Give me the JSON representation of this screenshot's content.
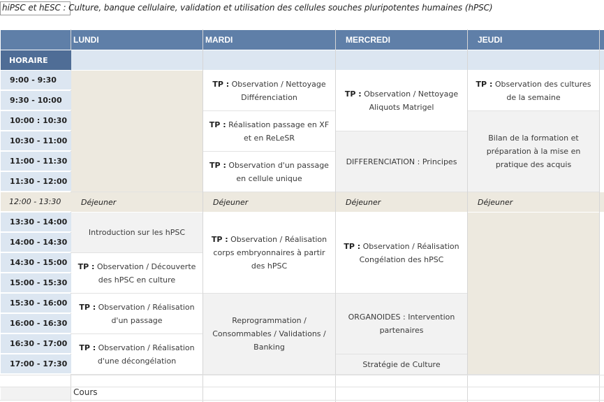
{
  "title": "hiPSC et hESC : Culture, banque cellulaire, validation et utilisation des cellules souches pluripotentes humaines (hPSC)",
  "days": [
    "LUNDI",
    "MARDI",
    "MERCREDI",
    "JEUDI"
  ],
  "horaire_label": "HORAIRE",
  "times": [
    "9:00 - 9:30",
    "9:30 - 10:00",
    "10:00 : 10:30",
    "10:30 - 11:00",
    "11:00 - 11:30",
    "11:30 - 12:00",
    "12:00 - 13:30",
    "13:30 - 14:00",
    "14:00 - 14:30",
    "14:30 - 15:00",
    "15:00 - 15:30",
    "15:30 - 16:00",
    "16:00 - 16:30",
    "16:30 - 17:00",
    "17:00 - 17:30"
  ],
  "lunch_label": "Déjeuner",
  "tp_prefix": "TP :",
  "cells": {
    "mardi_1": "Observation / Nettoyage Différenciation",
    "mardi_2": "Réalisation passage en XF et en ReLeSR",
    "mardi_3": "Observation d'un passage en cellule unique",
    "mercredi_1": "Observation /  Nettoyage Aliquots Matrigel",
    "mercredi_2": "DIFFERENCIATION : Principes",
    "jeudi_1": "Observation des cultures de la semaine",
    "jeudi_2": "Bilan de la formation et préparation à la mise en pratique des acquis",
    "lundi_pm_1": "Introduction sur les hPSC",
    "lundi_pm_2": "Observation / Découverte des hPSC en culture",
    "lundi_pm_3": "Observation / Réalisation d'un passage",
    "lundi_pm_4": "Observation / Réalisation d'une décongélation",
    "mardi_pm_1": "Observation / Réalisation corps embryonnaires à partir des hPSC",
    "mardi_pm_2": "Reprogrammation / Consommables / Validations / Banking",
    "mercredi_pm_1": "Observation / Réalisation Congélation des hPSC",
    "mercredi_pm_2": "ORGANOIDES : Intervention partenaires",
    "mercredi_pm_3": "Stratégie de Culture"
  },
  "legend": "Cours",
  "colors": {
    "header_blue": "#5f7fa8",
    "horaire_blue": "#4f6d96",
    "time_bg": "#dce6f1",
    "lunch_bg": "#ede9df",
    "grey_cell": "#f2f2f2"
  }
}
